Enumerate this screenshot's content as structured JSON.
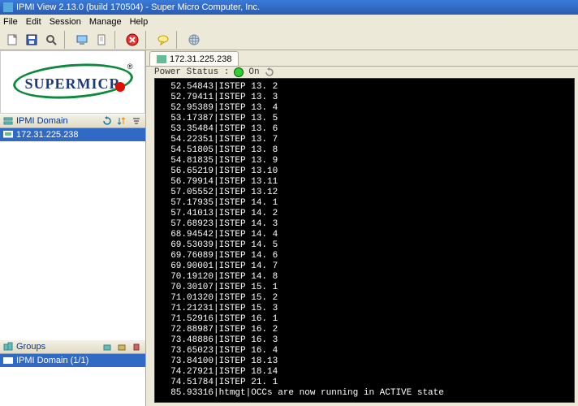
{
  "window": {
    "title": "IPMI View 2.13.0 (build 170504) - Super Micro Computer, Inc."
  },
  "menu": {
    "file": "File",
    "edit": "Edit",
    "session": "Session",
    "manage": "Manage",
    "help": "Help"
  },
  "logo": {
    "text": "SUPERMICR",
    "reg": "®"
  },
  "sidebar": {
    "domain_header": "IPMI Domain",
    "items": [
      {
        "label": "172.31.225.238"
      }
    ],
    "groups_header": "Groups",
    "groups": [
      {
        "label": "IPMI Domain (1/1)"
      }
    ]
  },
  "tabs": [
    {
      "label": "172.31.225.238"
    }
  ],
  "power": {
    "label": "Power Status :",
    "state": "On"
  },
  "console_lines": [
    "52.54843|ISTEP 13. 2",
    "52.79411|ISTEP 13. 3",
    "52.95389|ISTEP 13. 4",
    "53.17387|ISTEP 13. 5",
    "53.35484|ISTEP 13. 6",
    "54.22351|ISTEP 13. 7",
    "54.51805|ISTEP 13. 8",
    "54.81835|ISTEP 13. 9",
    "56.65219|ISTEP 13.10",
    "56.79914|ISTEP 13.11",
    "57.05552|ISTEP 13.12",
    "57.17935|ISTEP 14. 1",
    "57.41013|ISTEP 14. 2",
    "57.68923|ISTEP 14. 3",
    "68.94542|ISTEP 14. 4",
    "69.53039|ISTEP 14. 5",
    "69.76089|ISTEP 14. 6",
    "69.90001|ISTEP 14. 7",
    "70.19120|ISTEP 14. 8",
    "70.30107|ISTEP 15. 1",
    "71.01320|ISTEP 15. 2",
    "71.21231|ISTEP 15. 3",
    "71.52916|ISTEP 16. 1",
    "72.88987|ISTEP 16. 2",
    "73.48886|ISTEP 16. 3",
    "73.65023|ISTEP 16. 4",
    "73.84100|ISTEP 18.13",
    "74.27921|ISTEP 18.14",
    "74.51784|ISTEP 21. 1",
    "85.93316|htmgt|OCCs are now running in ACTIVE state"
  ]
}
